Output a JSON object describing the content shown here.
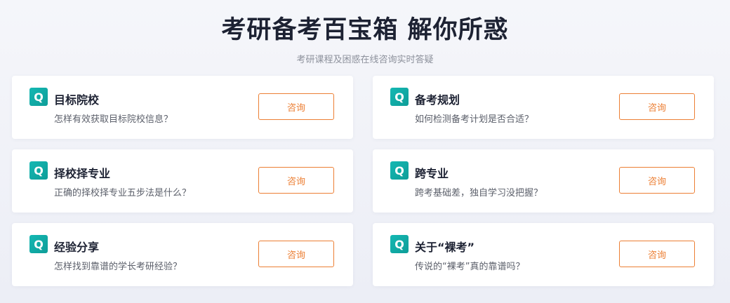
{
  "header": {
    "title": "考研备考百宝箱 解你所惑",
    "subtitle": "考研课程及困惑在线咨询实时答疑"
  },
  "badge_letter": "Q",
  "cards": [
    {
      "title": "目标院校",
      "desc": "怎样有效获取目标院校信息？",
      "button": "咨询"
    },
    {
      "title": "备考规划",
      "desc": "如何检测备考计划是否合适？",
      "button": "咨询"
    },
    {
      "title": "择校择专业",
      "desc": "正确的择校择专业五步法是什么？",
      "button": "咨询"
    },
    {
      "title": "跨专业",
      "desc": "跨考基础差，独自学习没把握？",
      "button": "咨询"
    },
    {
      "title": "经验分享",
      "desc": "怎样找到靠谱的学长考研经验？",
      "button": "咨询"
    },
    {
      "title": "关于“裸考”",
      "desc": "传说的“裸考”真的靠谱吗？",
      "button": "咨询"
    }
  ],
  "colors": {
    "accent_orange": "#ec7f34",
    "badge_teal": "#14b8b3",
    "title_dark": "#1d2233"
  }
}
